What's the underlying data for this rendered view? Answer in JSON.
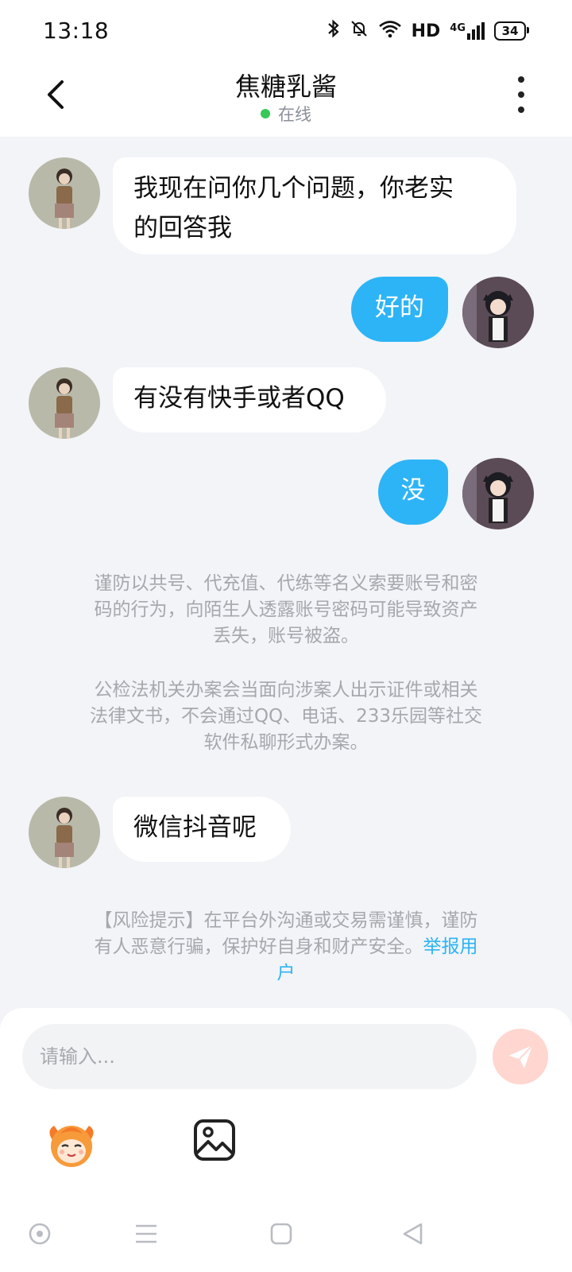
{
  "status_bar": {
    "time": "13:18",
    "icons": [
      "bluetooth-icon",
      "mute-icon",
      "wifi-icon",
      "HD",
      "4G",
      "signal-icon"
    ],
    "hd_label": "HD",
    "network_label": "4G",
    "battery_level": "34"
  },
  "header": {
    "title": "焦糖乳酱",
    "status": "在线",
    "status_color": "#37c957"
  },
  "messages": [
    {
      "side": "left",
      "text_line1": "我现在问你几个问题，你老实",
      "text_line2": "的回答我"
    },
    {
      "side": "right",
      "text": "好的"
    },
    {
      "side": "left",
      "text": "有没有快手或者QQ"
    },
    {
      "side": "right",
      "text": "没"
    },
    {
      "side": "left",
      "text": "微信抖音呢"
    }
  ],
  "notices": {
    "security_1_line1": "谨防以共号、代充值、代练等名义索要账号和密",
    "security_1_line2": "码的行为，向陌生人透露账号密码可能导致资产",
    "security_1_line3": "丢失，账号被盗。",
    "security_2_line1": "公检法机关办案会当面向涉案人出示证件或相关",
    "security_2_line2": "法律文书，不会通过QQ、电话、233乐园等社交",
    "security_2_line3": "软件私聊形式办案。",
    "risk_line1": "【风险提示】在平台外沟通或交易需谨慎，谨防",
    "risk_line2_text": "有人恶意行骗，保护好自身和财产安全。",
    "risk_link_part1": "举报用",
    "risk_link_part2": "户"
  },
  "input": {
    "placeholder": "请输入...",
    "value": ""
  },
  "toolbar": {
    "icons": [
      "emoji-mascot-icon",
      "image-icon"
    ]
  },
  "navbar": {
    "icons": [
      "circle-nav-icon",
      "menu-nav-icon",
      "home-square-icon",
      "back-triangle-icon"
    ]
  },
  "colors": {
    "accent": "#2db4f6",
    "background": "#f2f4f7",
    "notice_text": "#a5a8ad",
    "send_button": "#ffd6d0"
  }
}
